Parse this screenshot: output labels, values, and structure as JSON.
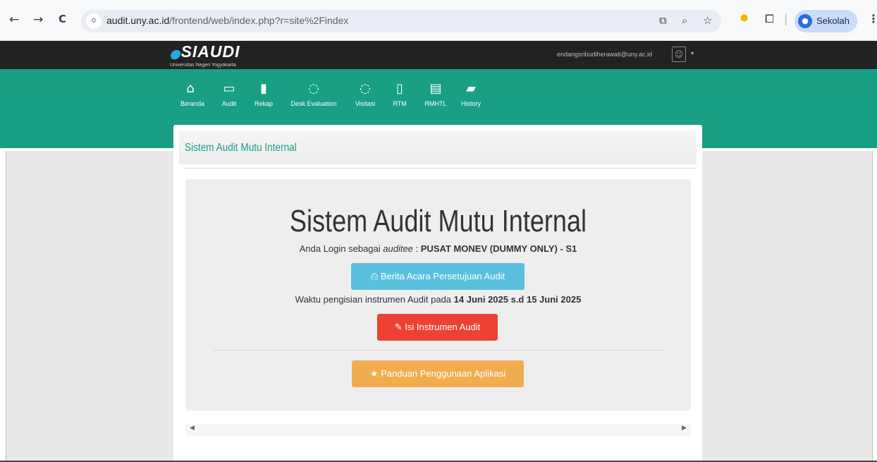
{
  "browser": {
    "back_glyph": "←",
    "forward_glyph": "→",
    "reload_glyph": "C",
    "site_info_glyph": "≎",
    "url_host": "audit.uny.ac.id",
    "url_path": "/frontend/web/index.php?r=site%2Findex",
    "translate_glyph": "⧉",
    "zoom_glyph": "⌕",
    "bookmark_glyph": "☆",
    "extension_glyph": "⬤",
    "extensions_glyph": "⧠",
    "profile_initial": "●",
    "profile_name": "Sekolah",
    "menu_glyph": "⋮"
  },
  "header": {
    "logo_prefix": "⬤",
    "logo_text": "SIAUDI",
    "logo_subtitle": "Universitas Negeri Yogyakarta",
    "user_email": "endangsribudiherawati@uny.ac.id",
    "user_avatar_glyph": "☺",
    "user_caret": "▾"
  },
  "menu": [
    {
      "icon": "⌂",
      "label": "Beranda"
    },
    {
      "icon": "▭",
      "label": "Audit"
    },
    {
      "icon": "▮",
      "label": "Rekap"
    },
    {
      "icon": "◌",
      "label": "Desk Evaluation"
    },
    {
      "icon": "◌",
      "label": "Visitasi"
    },
    {
      "icon": "▯",
      "label": "RTM"
    },
    {
      "icon": "▤",
      "label": "RMHTL"
    },
    {
      "icon": "▰",
      "label": "History"
    }
  ],
  "card": {
    "title": "Sistem Audit Mutu Internal"
  },
  "jumbotron": {
    "title": "Sistem Audit Mutu Internal",
    "login_prefix": "Anda Login sebagai ",
    "login_role": "auditee",
    "login_sep": " : ",
    "login_unit": "PUSAT MONEV (DUMMY ONLY) - S1",
    "berita_icon": "⎙",
    "berita_label": "Berita Acara Persetujuan Audit",
    "waktu_prefix": "Waktu pengisian instrumen Audit pada ",
    "waktu_range": "14 Juni 2025 s.d 15 Juni 2025",
    "isi_icon": "✎",
    "isi_label": "Isi Instrumen Audit",
    "panduan_icon": "★",
    "panduan_label": "Panduan Penggunaan Aplikasi"
  },
  "scroll": {
    "left_glyph": "◀",
    "right_glyph": "▶"
  },
  "colors": {
    "green": "#189f84",
    "info": "#5bc0de",
    "danger": "#ed4134",
    "warning": "#f0ad4e"
  }
}
